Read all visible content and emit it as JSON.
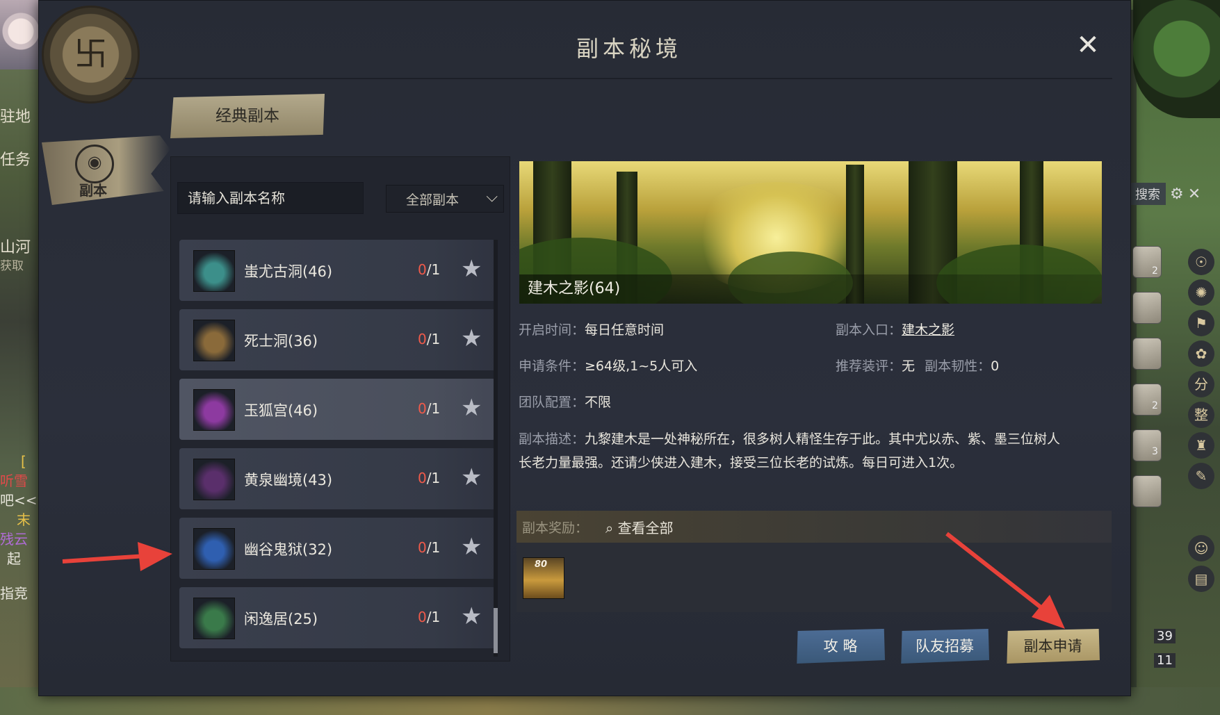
{
  "dialog": {
    "title": "副本秘境",
    "close_icon": "close-icon",
    "side_tab_label": "副本",
    "category_tab": "经典副本"
  },
  "search": {
    "placeholder": "请输入副本名称",
    "filter_value": "全部副本"
  },
  "dungeons": [
    {
      "name": "蚩尤古洞(46)",
      "count_done": "0",
      "count_total": "/1",
      "icon": "star-icon",
      "thumb_color": "#3c8f8a"
    },
    {
      "name": "死士洞(36)",
      "count_done": "0",
      "count_total": "/1",
      "icon": "star-icon",
      "thumb_color": "#8a6a3a"
    },
    {
      "name": "玉狐宫(46)",
      "count_done": "0",
      "count_total": "/1",
      "icon": "star-icon",
      "thumb_color": "#8d3aa0"
    },
    {
      "name": "黄泉幽境(43)",
      "count_done": "0",
      "count_total": "/1",
      "icon": "star-icon",
      "thumb_color": "#5a2f6b"
    },
    {
      "name": "幽谷鬼狱(32)",
      "count_done": "0",
      "count_total": "/1",
      "icon": "star-icon",
      "thumb_color": "#2f5fb0"
    },
    {
      "name": "闲逸居(25)",
      "count_done": "0",
      "count_total": "/1",
      "icon": "star-icon",
      "thumb_color": "#3a7a4a"
    }
  ],
  "detail": {
    "banner_caption": "建木之影(64)",
    "open_time_label": "开启时间：",
    "open_time_value": "每日任意时间",
    "entrance_label": "副本入口：",
    "entrance_value": "建木之影",
    "requirement_label": "申请条件：",
    "requirement_value": "≥64级,1~5人可入",
    "gear_label": "推荐装评：",
    "gear_value": "无",
    "toughness_label": "副本韧性：",
    "toughness_value": "0",
    "team_label": "团队配置：",
    "team_value": "不限",
    "desc_label": "副本描述：",
    "desc_value": "九黎建木是一处神秘所在，很多树人精怪生存于此。其中尤以赤、紫、墨三位树人长老力量最强。还请少侠进入建木，接受三位长老的试炼。每日可进入1次。",
    "reward_label": "副本奖励：",
    "reward_view_all": "查看全部",
    "reward_item_level": "80"
  },
  "buttons": {
    "guide": "攻 略",
    "recruit": "队友招募",
    "apply": "副本申请"
  },
  "hud": {
    "side_labels": [
      "驻地",
      "任务",
      "山河",
      "获取"
    ],
    "chat_lines": [
      "[",
      "听雪",
      "吧<<",
      "末",
      "残云",
      "起",
      "指竞"
    ],
    "search_label": "搜索",
    "hud_glyphs": [
      "分",
      "整"
    ],
    "counter_a": "39",
    "counter_b": "11",
    "slot_badges": [
      "2",
      "2",
      "3"
    ]
  }
}
